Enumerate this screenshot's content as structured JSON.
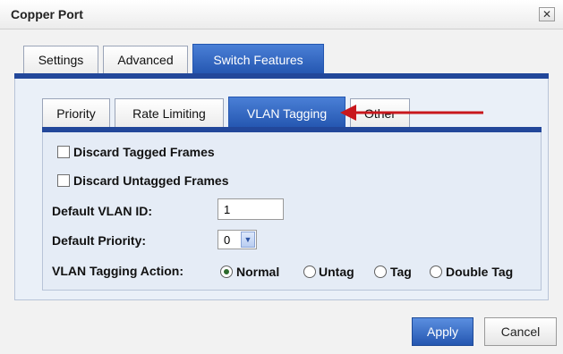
{
  "window": {
    "title": "Copper Port",
    "close_glyph": "✕"
  },
  "main_tabs": [
    {
      "label": "Settings",
      "active": false
    },
    {
      "label": "Advanced",
      "active": false
    },
    {
      "label": "Switch Features",
      "active": true
    }
  ],
  "sub_tabs": [
    {
      "label": "Priority",
      "active": false
    },
    {
      "label": "Rate Limiting",
      "active": false
    },
    {
      "label": "VLAN Tagging",
      "active": true
    },
    {
      "label": "Other",
      "active": false
    }
  ],
  "form": {
    "discard_tagged": {
      "label": "Discard Tagged Frames",
      "checked": false
    },
    "discard_untagged": {
      "label": "Discard Untagged Frames",
      "checked": false
    },
    "default_vlan_id": {
      "label": "Default VLAN ID:",
      "value": "1"
    },
    "default_priority": {
      "label": "Default Priority:",
      "value": "0"
    },
    "vlan_action": {
      "label": "VLAN Tagging Action:",
      "options": [
        "Normal",
        "Untag",
        "Tag",
        "Double Tag"
      ],
      "selected": "Normal"
    }
  },
  "buttons": {
    "apply": "Apply",
    "cancel": "Cancel"
  },
  "colors": {
    "accent": "#22479a",
    "annotation_arrow": "#c8171d"
  }
}
